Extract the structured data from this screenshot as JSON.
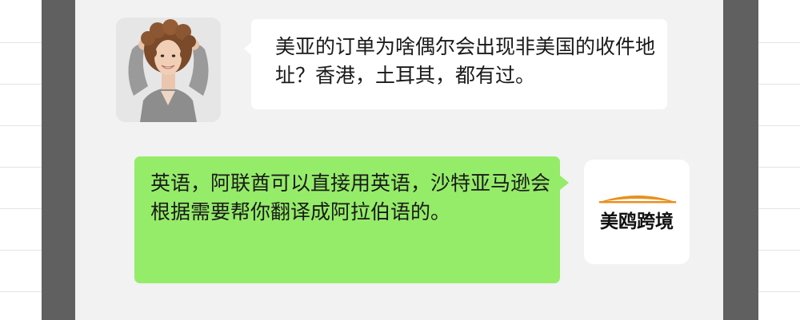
{
  "conversation": {
    "incoming": {
      "text": "美亚的订单为啥偶尔会出现非美国的收件地址？香港，土耳其，都有过。",
      "avatar": "woman-photo-avatar"
    },
    "outgoing": {
      "text": "英语，阿联酋可以直接用英语，沙特亚马逊会根据需要帮你翻译成阿拉伯语的。",
      "avatar": "brand-logo-avatar"
    }
  },
  "brand": {
    "name": "美鸥跨境"
  },
  "colors": {
    "outgoing_bubble": "#95ec69",
    "incoming_bubble": "#ffffff",
    "chat_background": "#f2f2f2",
    "frame": "#606060",
    "brand_arc": "#e8901e"
  }
}
